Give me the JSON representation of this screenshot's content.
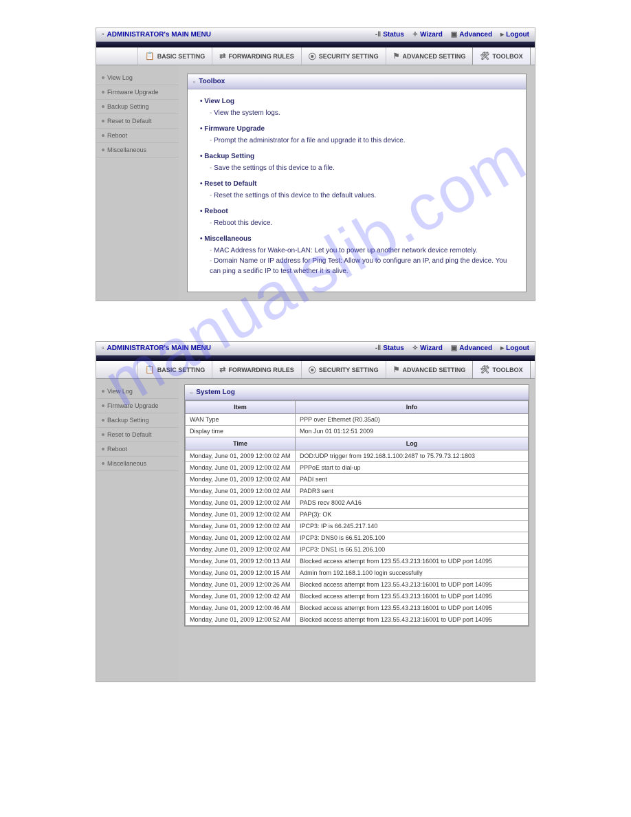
{
  "watermark": "manualslib.com",
  "topbar": {
    "title": "ADMINISTRATOR's MAIN MENU",
    "items": [
      {
        "label": "Status"
      },
      {
        "label": "Wizard"
      },
      {
        "label": "Advanced"
      },
      {
        "label": "Logout"
      }
    ]
  },
  "tabs": [
    {
      "label": "BASIC SETTING"
    },
    {
      "label": "FORWARDING RULES"
    },
    {
      "label": "SECURITY SETTING"
    },
    {
      "label": "ADVANCED SETTING"
    },
    {
      "label": "TOOLBOX",
      "active": true
    }
  ],
  "sidebar": {
    "items": [
      {
        "label": "View Log"
      },
      {
        "label": "Firmware Upgrade"
      },
      {
        "label": "Backup Setting"
      },
      {
        "label": "Reset to Default"
      },
      {
        "label": "Reboot"
      },
      {
        "label": "Miscellaneous"
      }
    ]
  },
  "toolbox": {
    "header": "Toolbox",
    "items": [
      {
        "title": "View Log",
        "descs": [
          "View the system logs."
        ]
      },
      {
        "title": "Firmware Upgrade",
        "descs": [
          "Prompt the administrator for a file and upgrade it to this device."
        ]
      },
      {
        "title": "Backup Setting",
        "descs": [
          "Save the settings of this device to a file."
        ]
      },
      {
        "title": "Reset to Default",
        "descs": [
          "Reset the settings of this device to the default values."
        ]
      },
      {
        "title": "Reboot",
        "descs": [
          "Reboot this device."
        ]
      },
      {
        "title": "Miscellaneous",
        "descs": [
          "MAC Address for Wake-on-LAN: Let you to power up another network device remotely.",
          "Domain Name or IP address for Ping Test: Allow you to configure an IP, and ping the device. You can ping a sedific IP to test whether it is alive."
        ]
      }
    ]
  },
  "syslog": {
    "header": "System Log",
    "head_item": "Item",
    "head_info": "Info",
    "head_time": "Time",
    "head_log": "Log",
    "info_rows": [
      {
        "item": "WAN Type",
        "info": "PPP over Ethernet (R0.35a0)"
      },
      {
        "item": "Display time",
        "info": "Mon Jun 01 01:12:51 2009"
      }
    ],
    "log_rows": [
      {
        "time": "Monday, June 01, 2009 12:00:02 AM",
        "log": "DOD:UDP trigger from 192.168.1.100:2487 to 75.79.73.12:1803"
      },
      {
        "time": "Monday, June 01, 2009 12:00:02 AM",
        "log": "PPPoE start to dial-up"
      },
      {
        "time": "Monday, June 01, 2009 12:00:02 AM",
        "log": "PADI sent"
      },
      {
        "time": "Monday, June 01, 2009 12:00:02 AM",
        "log": "PADR3 sent"
      },
      {
        "time": "Monday, June 01, 2009 12:00:02 AM",
        "log": "PADS recv 8002 AA16"
      },
      {
        "time": "Monday, June 01, 2009 12:00:02 AM",
        "log": "PAP(3): OK"
      },
      {
        "time": "Monday, June 01, 2009 12:00:02 AM",
        "log": "IPCP3: IP is 66.245.217.140"
      },
      {
        "time": "Monday, June 01, 2009 12:00:02 AM",
        "log": "IPCP3: DNS0 is 66.51.205.100"
      },
      {
        "time": "Monday, June 01, 2009 12:00:02 AM",
        "log": "IPCP3: DNS1 is 66.51.206.100"
      },
      {
        "time": "Monday, June 01, 2009 12:00:13 AM",
        "log": "Blocked access attempt from 123.55.43.213:16001 to UDP port 14095"
      },
      {
        "time": "Monday, June 01, 2009 12:00:15 AM",
        "log": "Admin from 192.168.1.100 login successfully"
      },
      {
        "time": "Monday, June 01, 2009 12:00:26 AM",
        "log": "Blocked access attempt from 123.55.43.213:16001 to UDP port 14095"
      },
      {
        "time": "Monday, June 01, 2009 12:00:42 AM",
        "log": "Blocked access attempt from 123.55.43.213:16001 to UDP port 14095"
      },
      {
        "time": "Monday, June 01, 2009 12:00:46 AM",
        "log": "Blocked access attempt from 123.55.43.213:16001 to UDP port 14095"
      },
      {
        "time": "Monday, June 01, 2009 12:00:52 AM",
        "log": "Blocked access attempt from 123.55.43.213:16001 to UDP port 14095"
      }
    ]
  }
}
